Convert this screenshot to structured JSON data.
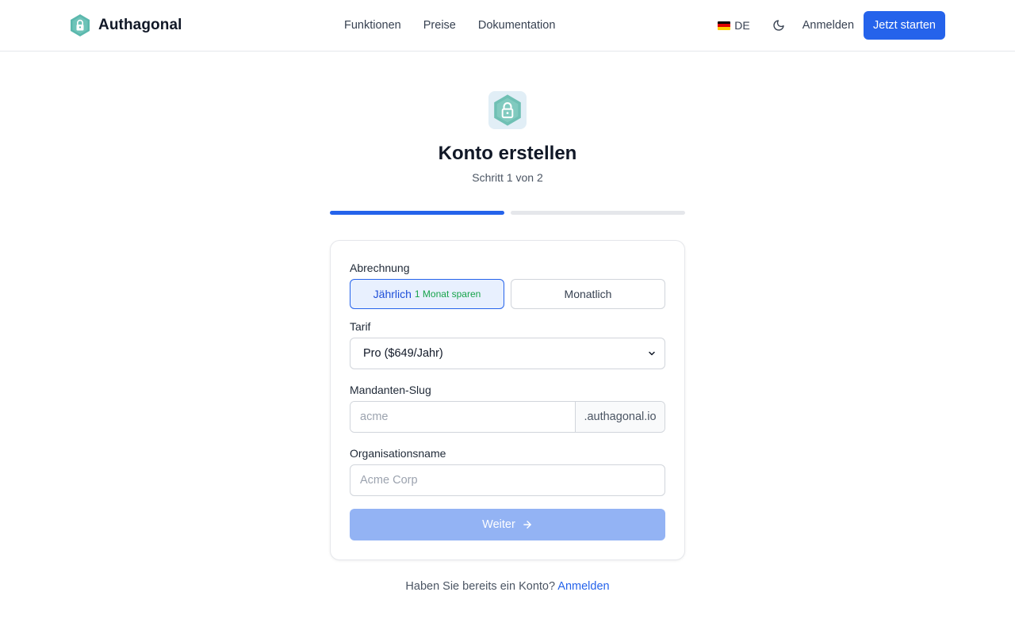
{
  "header": {
    "brand_name": "Authagonal",
    "nav": [
      "Funktionen",
      "Preise",
      "Dokumentation"
    ],
    "language": "DE",
    "signin_label": "Anmelden",
    "cta_label": "Jetzt starten"
  },
  "page": {
    "title": "Konto erstellen",
    "step_text": "Schritt 1 von 2",
    "progress": {
      "current_step": 1,
      "total_steps": 2
    }
  },
  "form": {
    "billing_label": "Abrechnung",
    "billing_yearly": "Jährlich",
    "billing_yearly_badge": "1 Monat sparen",
    "billing_monthly": "Monatlich",
    "billing_selected": "yearly",
    "plan_label": "Tarif",
    "plan_value": "Pro ($649/Jahr)",
    "slug_label": "Mandanten-Slug",
    "slug_placeholder": "acme",
    "slug_suffix": ".authagonal.io",
    "org_label": "Organisationsname",
    "org_placeholder": "Acme Corp",
    "next_label": "Weiter"
  },
  "footer": {
    "question": "Haben Sie bereits ein Konto?",
    "signin_link": "Anmelden"
  },
  "colors": {
    "primary": "#2563eb",
    "brand_teal": "#5bb8ad",
    "success": "#16a34a"
  }
}
